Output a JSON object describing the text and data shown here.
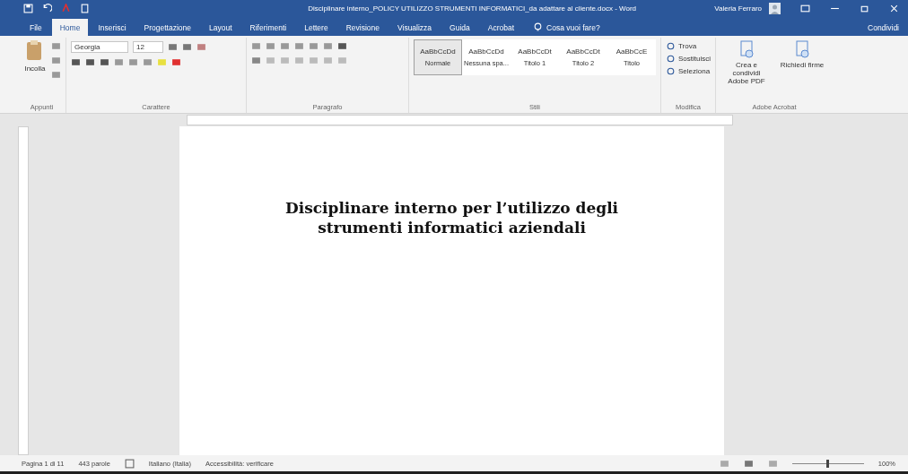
{
  "window": {
    "title": "Disciplinare interno_POLICY UTILIZZO STRUMENTI INFORMATICI_da adattare al cliente.docx - Word",
    "user": "Valeria Ferraro"
  },
  "tabs": [
    {
      "label": "File",
      "selected": false
    },
    {
      "label": "Home",
      "selected": true
    },
    {
      "label": "Inserisci",
      "selected": false
    },
    {
      "label": "Progettazione",
      "selected": false
    },
    {
      "label": "Layout",
      "selected": false
    },
    {
      "label": "Riferimenti",
      "selected": false
    },
    {
      "label": "Lettere",
      "selected": false
    },
    {
      "label": "Revisione",
      "selected": false
    },
    {
      "label": "Visualizza",
      "selected": false
    },
    {
      "label": "Guida",
      "selected": false
    },
    {
      "label": "Acrobat",
      "selected": false
    }
  ],
  "tell_me": {
    "placeholder": "Cosa vuoi fare?"
  },
  "share": "Condividi",
  "ribbon": {
    "paste": "Incolla",
    "clipboard": "Appunti",
    "font_name": "Georgia",
    "font_size": "12",
    "font_group": "Carattere",
    "paragraph_group": "Paragrafo",
    "styles": [
      {
        "sample": "AaBbCcDd",
        "name": "Normale",
        "selected": true
      },
      {
        "sample": "AaBbCcDd",
        "name": "Nessuna spa...",
        "selected": false
      },
      {
        "sample": "AaBbCcDt",
        "name": "Titolo 1",
        "selected": false
      },
      {
        "sample": "AaBbCcDt",
        "name": "Titolo 2",
        "selected": false
      },
      {
        "sample": "AaBbCcE",
        "name": "Titolo",
        "selected": false
      }
    ],
    "styles_group": "Stili",
    "editing": [
      "Trova",
      "Sostituisci",
      "Seleziona"
    ],
    "editing_group": "Modifica",
    "acrobat": [
      "Crea e condividi Adobe PDF",
      "Richiedi firme"
    ],
    "acrobat_group": "Adobe Acrobat"
  },
  "document": {
    "heading": "Disciplinare interno per l’utilizzo degli strumenti informatici aziendali"
  },
  "status_bar": {
    "page": "Pagina 1 di 11",
    "words": "443 parole",
    "language": "Italiano (Italia)",
    "accessibility": "Accessibilità: verificare",
    "zoom": "100%",
    "zoom_slider": {
      "level": 0.5
    }
  }
}
